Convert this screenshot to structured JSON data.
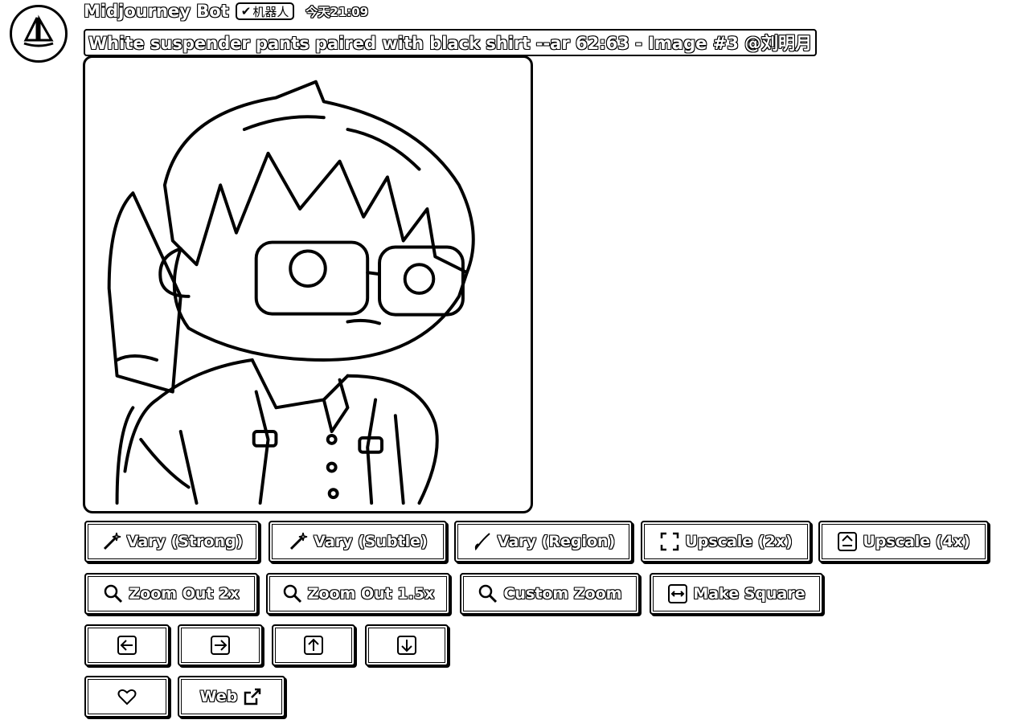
{
  "header": {
    "bot_name": "Midjourney Bot",
    "bot_tag": "机器人",
    "timestamp": "今天21:09",
    "prompt": "White suspender pants paired with black shirt --ar 62:63 - Image #3 @刘明月"
  },
  "image": {
    "alt": "Chibi character with glasses wearing shirt and suspenders"
  },
  "buttons": {
    "vary_strong": "Vary (Strong)",
    "vary_subtle": "Vary (Subtle)",
    "vary_region": "Vary (Region)",
    "upscale_2x": "Upscale (2x)",
    "upscale_4x": "Upscale (4x)",
    "zoom_out_2x": "Zoom Out 2x",
    "zoom_out_1_5x": "Zoom Out 1.5x",
    "custom_zoom": "Custom Zoom",
    "make_square": "Make Square",
    "web": "Web"
  },
  "icons": {
    "avatar": "sailboat-icon",
    "vary": "magic-wand-icon",
    "region": "brush-icon",
    "upscale_2x": "expand-icon",
    "upscale_4x": "double-up-icon",
    "zoom": "magnifier-icon",
    "square": "square-arrows-icon",
    "pan_left": "arrow-left-icon",
    "pan_right": "arrow-right-icon",
    "pan_up": "arrow-up-icon",
    "pan_down": "arrow-down-icon",
    "favorite": "heart-icon",
    "external": "external-link-icon"
  }
}
